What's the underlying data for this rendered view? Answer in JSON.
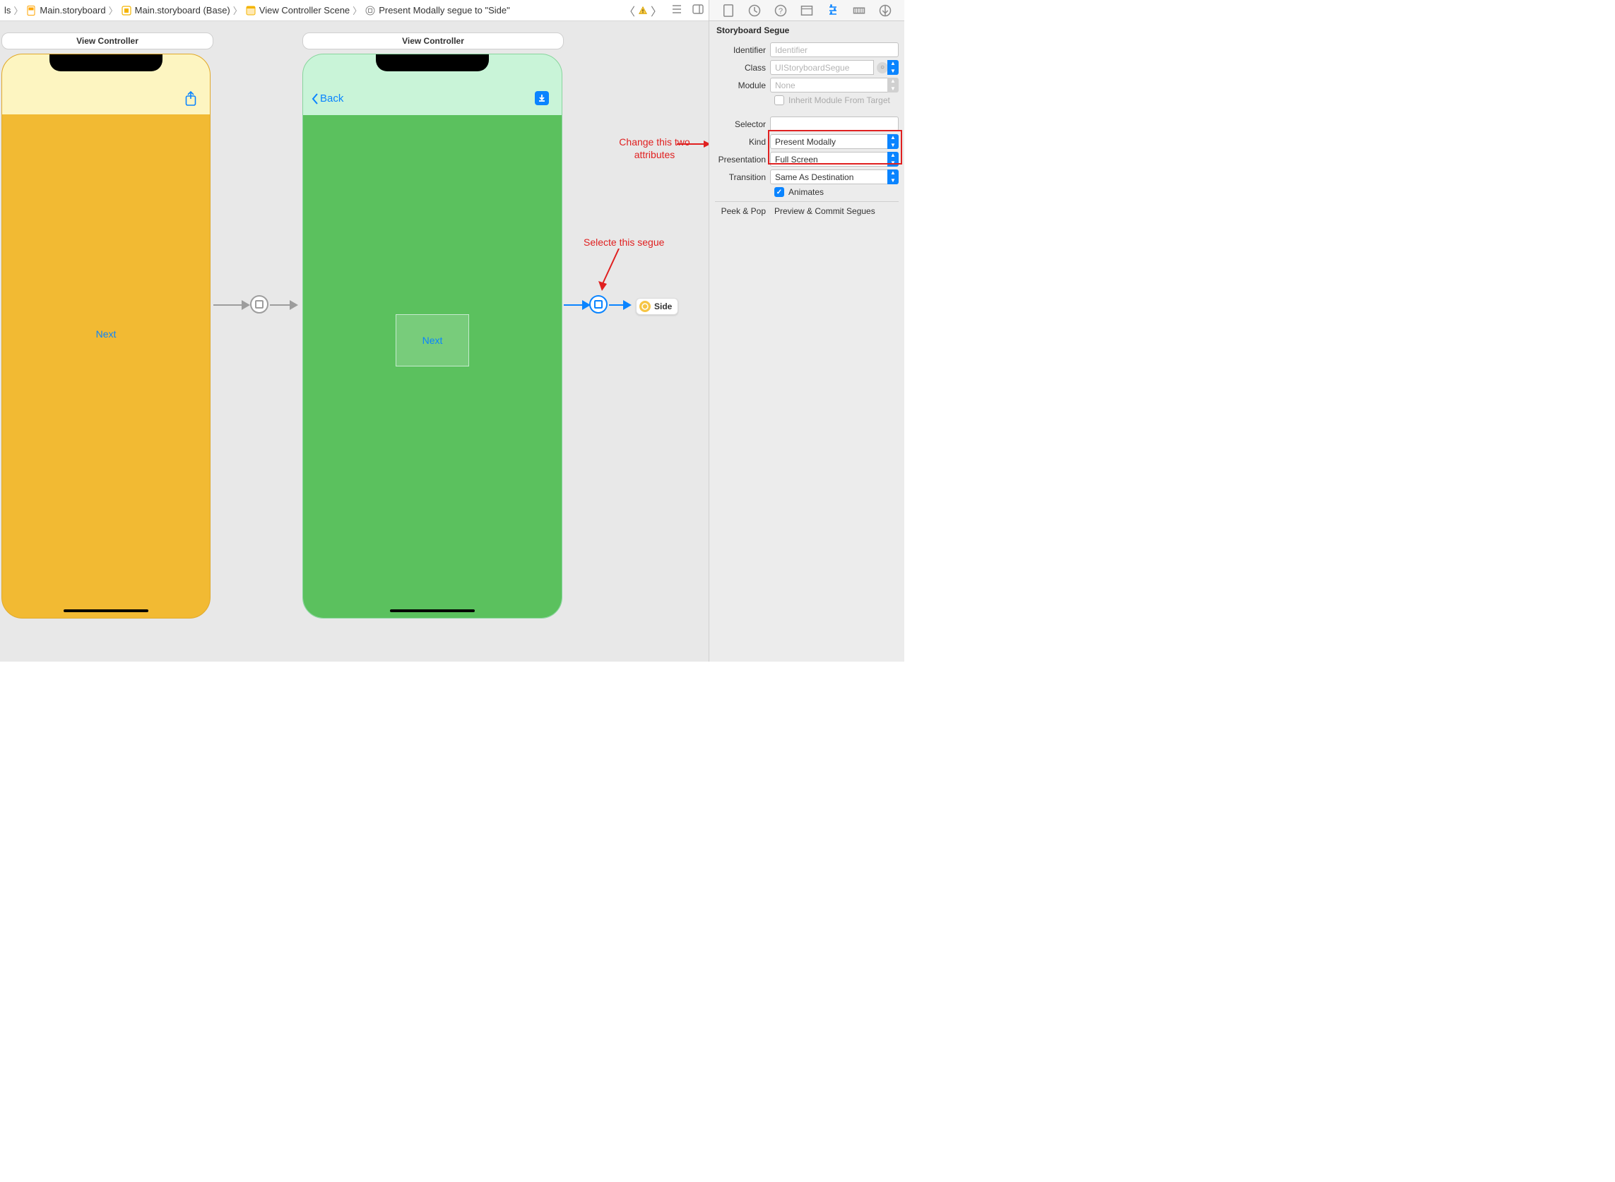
{
  "breadcrumb": {
    "item0": "ls",
    "item1": "Main.storyboard",
    "item2": "Main.storyboard (Base)",
    "item3": "View Controller Scene",
    "item4": "Present Modally segue to \"Side\""
  },
  "scenes": {
    "left": {
      "title": "View Controller",
      "next_btn": "Next"
    },
    "right": {
      "title": "View Controller",
      "back_btn": "Back",
      "next_btn": "Next"
    },
    "side_badge": "Side"
  },
  "annotations": {
    "change_attrs": "Change this two attributes",
    "select_segue": "Selecte this segue"
  },
  "inspector": {
    "section_title": "Storyboard Segue",
    "identifier": {
      "label": "Identifier",
      "placeholder": "Identifier",
      "value": ""
    },
    "cls": {
      "label": "Class",
      "placeholder": "UIStoryboardSegue",
      "value": ""
    },
    "module": {
      "label": "Module",
      "placeholder": "None",
      "value": ""
    },
    "inherit": {
      "label": "Inherit Module From Target",
      "checked": false
    },
    "selector": {
      "label": "Selector",
      "value": ""
    },
    "kind": {
      "label": "Kind",
      "value": "Present Modally"
    },
    "presentation": {
      "label": "Presentation",
      "value": "Full Screen"
    },
    "transition": {
      "label": "Transition",
      "value": "Same As Destination"
    },
    "animates": {
      "label": "Animates",
      "checked": true
    },
    "peekpop": {
      "label": "Peek & Pop",
      "option": "Preview & Commit Segues",
      "checked": false
    }
  }
}
